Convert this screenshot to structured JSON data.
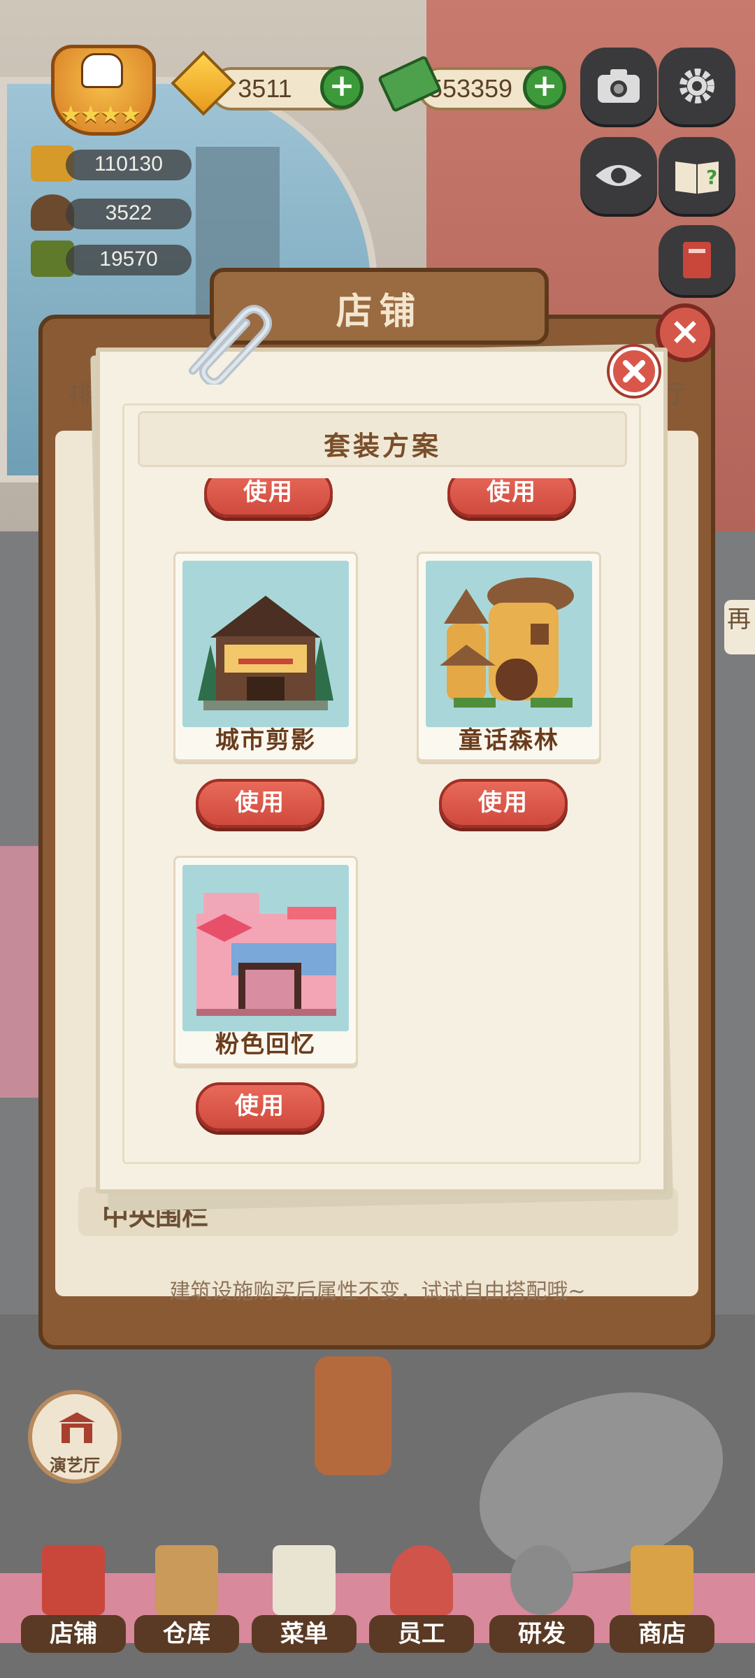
{
  "hud": {
    "gems": "3511",
    "cash": "553359",
    "stat1": "110130",
    "stat2": "3522",
    "stat3": "19570"
  },
  "shop": {
    "title": "店铺",
    "left_tab": "排",
    "right_tab": "厅",
    "side_tag": "再",
    "footer_item": "中央围栏",
    "hint": "建筑设施购买后属性不变，试试自由搭配哦~"
  },
  "modal": {
    "title": "套装方案",
    "use_label": "使用",
    "cards": [
      {
        "name": "城市剪影"
      },
      {
        "name": "童话森林"
      },
      {
        "name": "粉色回忆"
      }
    ]
  },
  "theater": {
    "label": "演艺厅"
  },
  "nav": [
    {
      "label": "店铺"
    },
    {
      "label": "仓库"
    },
    {
      "label": "菜单"
    },
    {
      "label": "员工"
    },
    {
      "label": "研发"
    },
    {
      "label": "商店"
    }
  ],
  "icons": [
    "chef-badge-icon",
    "gem-icon",
    "cash-icon",
    "camera-icon",
    "gear-icon",
    "eye-icon",
    "help-book-icon",
    "recipe-book-icon",
    "paperclip-icon",
    "close-icon",
    "plus-icon"
  ],
  "colors": {
    "accent_red": "#d9574a",
    "plus_green": "#3d9a3a",
    "panel_brown": "#8a5a35"
  }
}
